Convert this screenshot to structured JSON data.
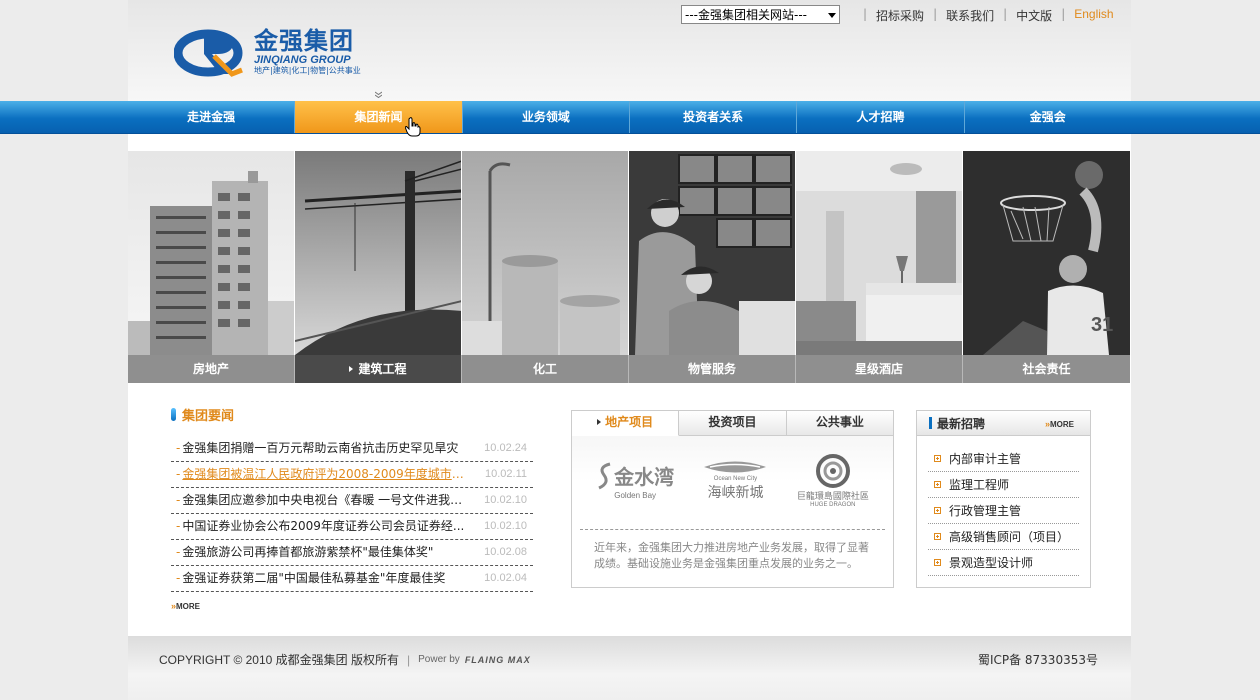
{
  "header": {
    "logo_cn": "金强集团",
    "logo_en": "JINQIANG GROUP",
    "logo_sub": "地产|建筑|化工|物管|公共事业",
    "site_select": "---金强集团相关网站---",
    "toplinks": [
      "招标采购",
      "联系我们",
      "中文版",
      "English"
    ]
  },
  "nav": {
    "items": [
      "走进金强",
      "集团新闻",
      "业务领域",
      "投资者关系",
      "人才招聘",
      "金强会"
    ],
    "active_index": 1
  },
  "banner": {
    "captions": [
      "房地产",
      "建筑工程",
      "化工",
      "物管服务",
      "星级酒店",
      "社会责任"
    ],
    "active_index": 1
  },
  "news": {
    "title": "集团要闻",
    "items": [
      {
        "text": "金强集团捐赠一百万元帮助云南省抗击历史罕见旱灾",
        "date": "10.02.24"
      },
      {
        "text": "金强集团被温江人民政府评为2008-2009年度城市建...",
        "date": "10.02.11"
      },
      {
        "text": "金强集团应邀参加中央电视台《春暖 一号文件进我家...",
        "date": "10.02.10"
      },
      {
        "text": "中国证券业协会公布2009年度证券公司会员证券经...",
        "date": "10.02.10"
      },
      {
        "text": "金强旅游公司再捧首都旅游紫禁杯\"最佳集体奖\"",
        "date": "10.02.08"
      },
      {
        "text": "金强证券获第二届\"中国最佳私募基金\"年度最佳奖",
        "date": "10.02.04"
      }
    ],
    "more": "MORE"
  },
  "projects": {
    "tabs": [
      "地产项目",
      "投资项目",
      "公共事业"
    ],
    "active_index": 0,
    "logos": [
      {
        "name": "金水湾",
        "sub": "Golden Bay"
      },
      {
        "name": "海峡新城",
        "sub": "Ocean New City"
      },
      {
        "name": "巨龍環島國際社區",
        "sub": "HUGE DRAGON"
      }
    ],
    "desc": "近年来，金强集团大力推进房地产业务发展，取得了显著成绩。基础设施业务是金强集团重点发展的业务之一。"
  },
  "jobs": {
    "title": "最新招聘",
    "more": "MORE",
    "items": [
      "内部审计主管",
      "监理工程师",
      "行政管理主管",
      "高级销售顾问（项目）",
      "景观造型设计师"
    ]
  },
  "footer": {
    "copyright": "COPYRIGHT © 2010 成都金强集团 版权所有",
    "powered": "Power by",
    "brand": "FLAING MAX",
    "icp": "蜀ICP备 87330353号"
  },
  "colors": {
    "accent": "#e08a1c",
    "nav_blue": "#0a6fc0",
    "caption_gray": "#8f8f8f"
  }
}
